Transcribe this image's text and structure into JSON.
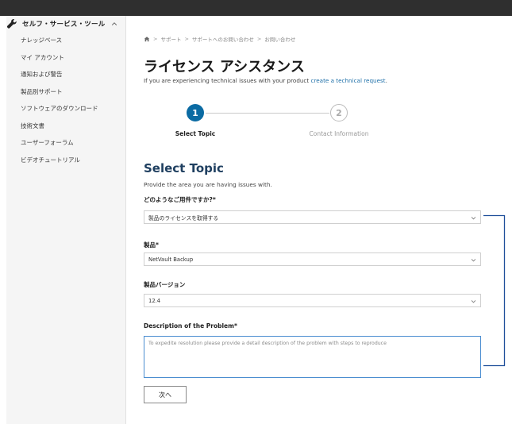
{
  "sidebar": {
    "heading": "セルフ・サービス・ツール",
    "items": [
      {
        "label": "ナレッジベース"
      },
      {
        "label": "マイ アカウント"
      },
      {
        "label": "通知および警告"
      },
      {
        "label": "製品別サポート"
      },
      {
        "label": "ソフトウェアのダウンロード"
      },
      {
        "label": "技術文書"
      },
      {
        "label": "ユーザーフォーラム"
      },
      {
        "label": "ビデオチュートリアル"
      }
    ]
  },
  "breadcrumb": {
    "sep": ">",
    "items": [
      "サポート",
      "サポートへのお問い合わせ",
      "お問い合わせ"
    ]
  },
  "page": {
    "title": "ライセンス アシスタンス",
    "intro_text": "If you are experiencing technical issues with your product ",
    "intro_link": "create a technical request",
    "intro_end": "."
  },
  "stepper": {
    "steps": [
      {
        "number": "1",
        "label": "Select Topic"
      },
      {
        "number": "2",
        "label": "Contact Information"
      }
    ]
  },
  "form": {
    "section_title": "Select Topic",
    "section_subtitle": "Provide the area you are having issues with.",
    "topic_label": "どのようなご用件ですか?*",
    "topic_value": "製品のライセンスを取得する",
    "product_label": "製品*",
    "product_value": "NetVault Backup",
    "version_label": "製品バージョン",
    "version_value": "12.4",
    "description_label": "Description of the Problem*",
    "description_placeholder": "To expedite resolution please provide a detail description of the problem with steps to reproduce",
    "next_label": "次へ"
  },
  "colors": {
    "accent": "#0b6ba3",
    "title": "#1f3f60",
    "link": "#1d6fa8",
    "focus_border": "#4a8dd0",
    "bracket": "#1f4f9a"
  },
  "icons": {
    "sidebar_head": "wrench-icon",
    "sidebar_toggle": "chevron-up-icon",
    "breadcrumb_home": "home-icon",
    "select": "chevron-down-icon"
  }
}
